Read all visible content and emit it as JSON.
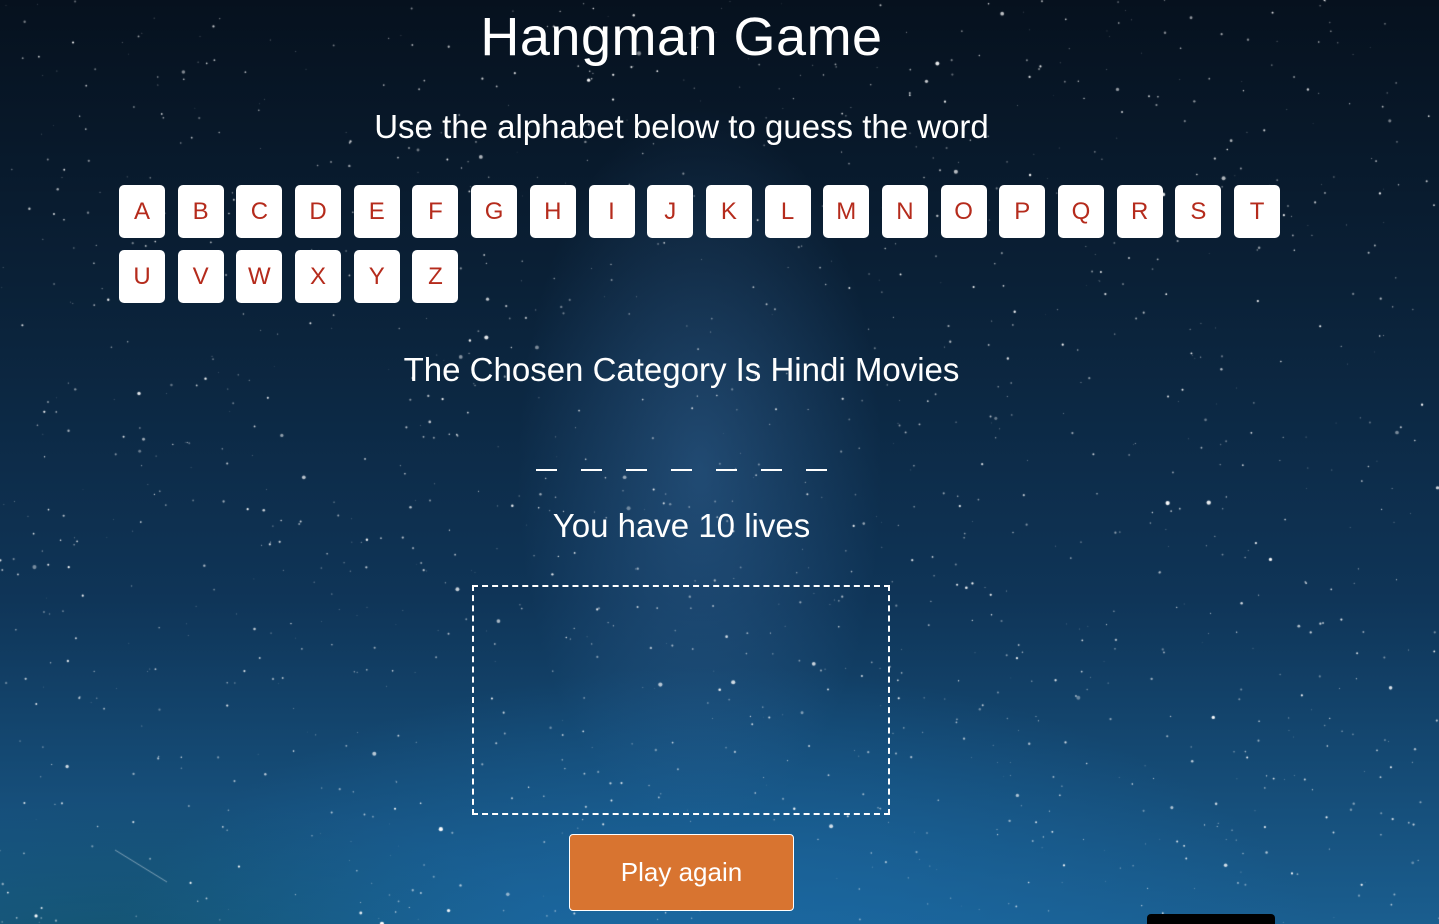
{
  "header": {
    "title": "Hangman Game",
    "instructions": "Use the alphabet below to guess the word"
  },
  "alphabet": [
    "A",
    "B",
    "C",
    "D",
    "E",
    "F",
    "G",
    "H",
    "I",
    "J",
    "K",
    "L",
    "M",
    "N",
    "O",
    "P",
    "Q",
    "R",
    "S",
    "T",
    "U",
    "V",
    "W",
    "X",
    "Y",
    "Z"
  ],
  "game": {
    "category": "The Chosen Category Is Hindi Movies",
    "word_length": 7,
    "lives_text": "You have 10 lives",
    "play_again_label": "Play again"
  },
  "colors": {
    "letter_text": "#b52b1c",
    "letter_tile": "#ffffff",
    "button_bg": "#d87430",
    "sky_top": "#06111e",
    "sky_bottom": "#1a5e8f"
  }
}
